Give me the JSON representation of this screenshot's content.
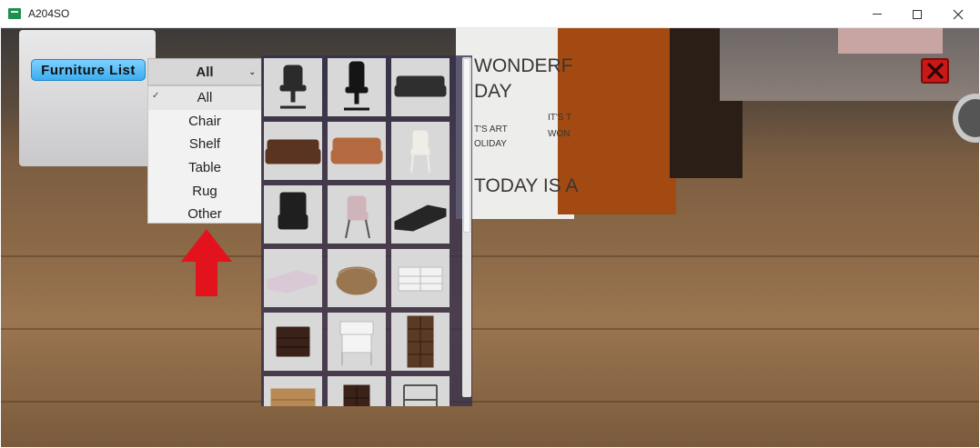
{
  "window": {
    "title": "A204SO",
    "controls": {
      "minimize": "minimize",
      "maximize": "maximize",
      "close": "close"
    }
  },
  "furniture_list_button": {
    "label": "Furniture List"
  },
  "category_dropdown": {
    "selected": "All",
    "options": [
      "All",
      "Chair",
      "Shelf",
      "Table",
      "Rug",
      "Other"
    ]
  },
  "poster": {
    "line1": "WONDERF",
    "line2": "DAY",
    "line3": "TODAY IS A",
    "small1": "IT'S T",
    "small2": "WON",
    "small3": "T'S ART",
    "small4": "OLIDAY"
  },
  "furniture_items": [
    {
      "type": "office-chair",
      "color": "#2b2b2b"
    },
    {
      "type": "office-chair-tall",
      "color": "#151515"
    },
    {
      "type": "sofa-dark",
      "color": "#2f2f2f"
    },
    {
      "type": "sofa-brown",
      "color": "#5a3420"
    },
    {
      "type": "sofa-tan",
      "color": "#b46a40"
    },
    {
      "type": "chair-white",
      "color": "#f0ede6"
    },
    {
      "type": "armchair-black",
      "color": "#1f1f1f"
    },
    {
      "type": "chair-pink",
      "color": "#cfb4b9"
    },
    {
      "type": "sectional-dark",
      "color": "#262626"
    },
    {
      "type": "sectional-pink",
      "color": "#d9c9d6"
    },
    {
      "type": "pouf-rattan",
      "color": "#9a7650"
    },
    {
      "type": "dresser-white",
      "color": "#f2f2f2"
    },
    {
      "type": "nightstand-dark",
      "color": "#3b2219"
    },
    {
      "type": "nightstand-white",
      "color": "#f4f4f4"
    },
    {
      "type": "bookcase-brown",
      "color": "#5b3a25"
    },
    {
      "type": "cabinet-wood",
      "color": "#b88a55"
    },
    {
      "type": "shelf-dark",
      "color": "#3a2218"
    },
    {
      "type": "rack-metal",
      "color": "#8a8a8a"
    }
  ],
  "icons": {
    "close": "close-x-icon",
    "arrow": "up-arrow-icon",
    "chevron": "chevron-down-icon",
    "check": "check-icon"
  },
  "colors": {
    "button_blue": "#3aaef0",
    "close_red": "#c91818",
    "arrow_red": "#e3131d",
    "panel": "#34304e"
  }
}
